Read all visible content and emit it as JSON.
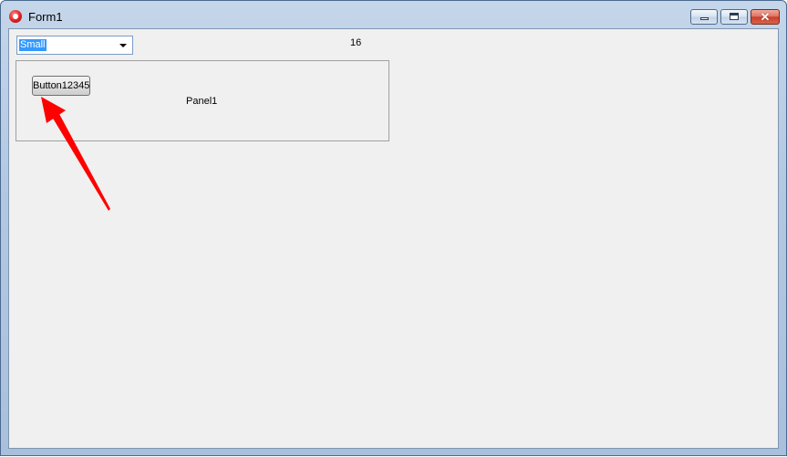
{
  "window": {
    "title": "Form1",
    "app_icon": "app-icon",
    "caption_buttons": {
      "minimize_icon": "minimize-icon",
      "maximize_icon": "maximize-icon",
      "close_icon": "close-icon",
      "close_glyph": "✕"
    }
  },
  "form": {
    "combo": {
      "selected_value": "Small",
      "arrow_icon": "dropdown-arrow-icon"
    },
    "size_label": "16",
    "panel": {
      "caption": "Panel1",
      "button_label": "Button12345"
    }
  },
  "annotation": {
    "arrow_color": "#ff0000",
    "arrow_icon": "red-pointer-arrow-icon"
  },
  "colors": {
    "selection_highlight": "#3399ff",
    "client_background": "#f0f0f0"
  }
}
